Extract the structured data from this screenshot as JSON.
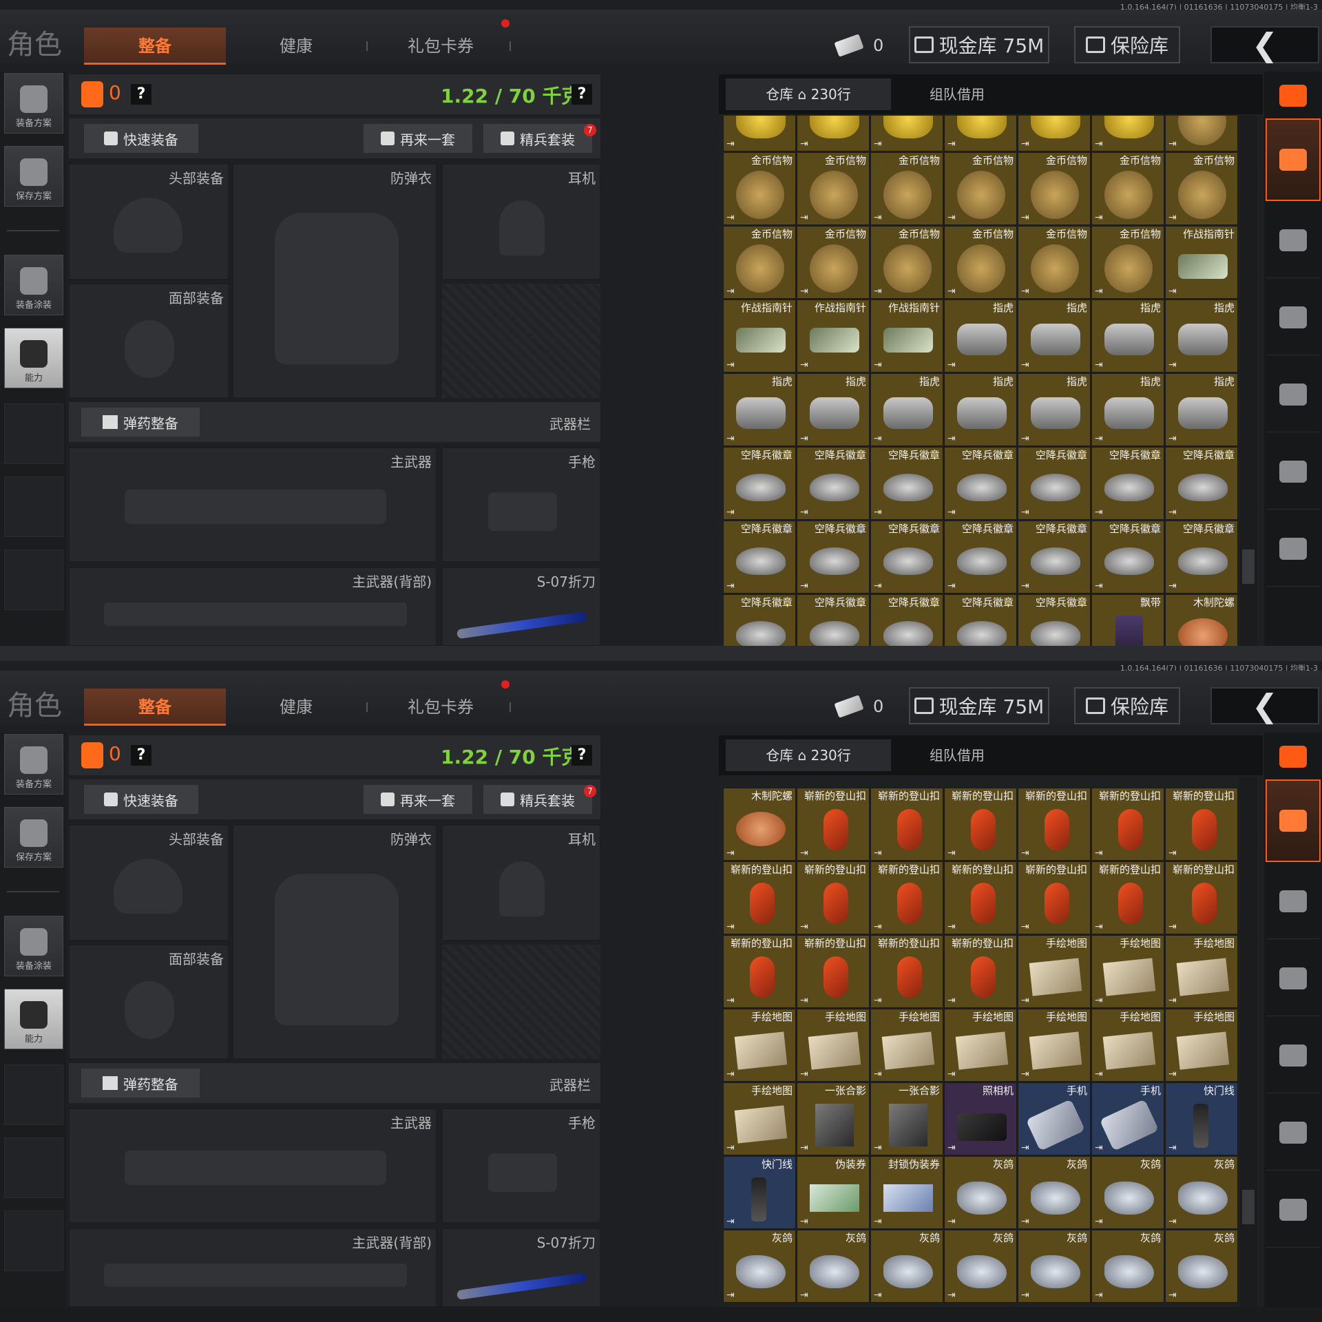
{
  "version_text": "1.0.164.164(7) | 01161636 | 11073040175 | 均衡1-3",
  "header": {
    "title": "角色",
    "tabs": [
      {
        "label": "整备",
        "active": true
      },
      {
        "label": "健康",
        "active": false
      },
      {
        "label": "礼包卡券",
        "active": false
      }
    ],
    "ticket_count": "0",
    "cash_vault": "现金库 75M",
    "safe": "保险库",
    "back_icon": "chevron-left-icon"
  },
  "sidebar": {
    "items": [
      {
        "label": "装备方案",
        "icon": "backpack-icon"
      },
      {
        "label": "保存方案",
        "icon": "download-icon"
      },
      {
        "label": "装备涂装",
        "icon": "helmet-paint-icon"
      },
      {
        "label": "能力",
        "icon": "lightning-icon"
      }
    ]
  },
  "loadout": {
    "armor_count": "0",
    "help": "?",
    "weight": "1.22 / 70 千克",
    "quick_equip": "快速装备",
    "repeat": "再来一套",
    "elite_set": "精兵套装",
    "elite_badge": "7",
    "slots": {
      "head": "头部装备",
      "vest": "防弹衣",
      "earphones": "耳机",
      "face": "面部装备"
    },
    "ammo_btn": "弹药整备",
    "weapon_bar": "武器栏",
    "weapons": {
      "primary": "主武器",
      "pistol": "手枪",
      "primary_back": "主武器(背部)",
      "knife": "S-07折刀"
    }
  },
  "inventory": {
    "tab_warehouse": "仓库",
    "row_count": "230行",
    "tab_team": "组队借用",
    "panel1_rows": [
      [
        {
          "n": "",
          "t": "gold"
        },
        {
          "n": "",
          "t": "gold"
        },
        {
          "n": "",
          "t": "gold"
        },
        {
          "n": "",
          "t": "gold"
        },
        {
          "n": "",
          "t": "gold"
        },
        {
          "n": "",
          "t": "gold"
        },
        {
          "n": "",
          "t": "coin"
        }
      ],
      [
        {
          "n": "金币信物",
          "t": "coin"
        },
        {
          "n": "金币信物",
          "t": "coin"
        },
        {
          "n": "金币信物",
          "t": "coin"
        },
        {
          "n": "金币信物",
          "t": "coin"
        },
        {
          "n": "金币信物",
          "t": "coin"
        },
        {
          "n": "金币信物",
          "t": "coin"
        },
        {
          "n": "金币信物",
          "t": "coin"
        }
      ],
      [
        {
          "n": "金币信物",
          "t": "coin"
        },
        {
          "n": "金币信物",
          "t": "coin"
        },
        {
          "n": "金币信物",
          "t": "coin"
        },
        {
          "n": "金币信物",
          "t": "coin"
        },
        {
          "n": "金币信物",
          "t": "coin"
        },
        {
          "n": "金币信物",
          "t": "coin"
        },
        {
          "n": "作战指南针",
          "t": "compass"
        }
      ],
      [
        {
          "n": "作战指南针",
          "t": "compass"
        },
        {
          "n": "作战指南针",
          "t": "compass"
        },
        {
          "n": "作战指南针",
          "t": "compass"
        },
        {
          "n": "指虎",
          "t": "knuckle"
        },
        {
          "n": "指虎",
          "t": "knuckle"
        },
        {
          "n": "指虎",
          "t": "knuckle"
        },
        {
          "n": "指虎",
          "t": "knuckle"
        }
      ],
      [
        {
          "n": "指虎",
          "t": "knuckle"
        },
        {
          "n": "指虎",
          "t": "knuckle"
        },
        {
          "n": "指虎",
          "t": "knuckle"
        },
        {
          "n": "指虎",
          "t": "knuckle"
        },
        {
          "n": "指虎",
          "t": "knuckle"
        },
        {
          "n": "指虎",
          "t": "knuckle"
        },
        {
          "n": "指虎",
          "t": "knuckle"
        }
      ],
      [
        {
          "n": "空降兵徽章",
          "t": "badge"
        },
        {
          "n": "空降兵徽章",
          "t": "badge"
        },
        {
          "n": "空降兵徽章",
          "t": "badge"
        },
        {
          "n": "空降兵徽章",
          "t": "badge"
        },
        {
          "n": "空降兵徽章",
          "t": "badge"
        },
        {
          "n": "空降兵徽章",
          "t": "badge"
        },
        {
          "n": "空降兵徽章",
          "t": "badge"
        }
      ],
      [
        {
          "n": "空降兵徽章",
          "t": "badge"
        },
        {
          "n": "空降兵徽章",
          "t": "badge"
        },
        {
          "n": "空降兵徽章",
          "t": "badge"
        },
        {
          "n": "空降兵徽章",
          "t": "badge"
        },
        {
          "n": "空降兵徽章",
          "t": "badge"
        },
        {
          "n": "空降兵徽章",
          "t": "badge"
        },
        {
          "n": "空降兵徽章",
          "t": "badge"
        }
      ],
      [
        {
          "n": "空降兵徽章",
          "t": "badge"
        },
        {
          "n": "空降兵徽章",
          "t": "badge"
        },
        {
          "n": "空降兵徽章",
          "t": "badge"
        },
        {
          "n": "空降兵徽章",
          "t": "badge"
        },
        {
          "n": "空降兵徽章",
          "t": "badge"
        },
        {
          "n": "飘带",
          "t": "ribbon"
        },
        {
          "n": "木制陀螺",
          "t": "top"
        }
      ]
    ],
    "panel2_rows": [
      [
        {
          "n": "木制陀螺",
          "t": "top"
        },
        {
          "n": "崭新的登山扣",
          "t": "clip"
        },
        {
          "n": "崭新的登山扣",
          "t": "clip"
        },
        {
          "n": "崭新的登山扣",
          "t": "clip"
        },
        {
          "n": "崭新的登山扣",
          "t": "clip"
        },
        {
          "n": "崭新的登山扣",
          "t": "clip"
        },
        {
          "n": "崭新的登山扣",
          "t": "clip"
        }
      ],
      [
        {
          "n": "崭新的登山扣",
          "t": "clip"
        },
        {
          "n": "崭新的登山扣",
          "t": "clip"
        },
        {
          "n": "崭新的登山扣",
          "t": "clip"
        },
        {
          "n": "崭新的登山扣",
          "t": "clip"
        },
        {
          "n": "崭新的登山扣",
          "t": "clip"
        },
        {
          "n": "崭新的登山扣",
          "t": "clip"
        },
        {
          "n": "崭新的登山扣",
          "t": "clip"
        }
      ],
      [
        {
          "n": "崭新的登山扣",
          "t": "clip"
        },
        {
          "n": "崭新的登山扣",
          "t": "clip"
        },
        {
          "n": "崭新的登山扣",
          "t": "clip"
        },
        {
          "n": "崭新的登山扣",
          "t": "clip"
        },
        {
          "n": "手绘地图",
          "t": "map"
        },
        {
          "n": "手绘地图",
          "t": "map"
        },
        {
          "n": "手绘地图",
          "t": "map"
        }
      ],
      [
        {
          "n": "手绘地图",
          "t": "map"
        },
        {
          "n": "手绘地图",
          "t": "map"
        },
        {
          "n": "手绘地图",
          "t": "map"
        },
        {
          "n": "手绘地图",
          "t": "map"
        },
        {
          "n": "手绘地图",
          "t": "map"
        },
        {
          "n": "手绘地图",
          "t": "map"
        },
        {
          "n": "手绘地图",
          "t": "map"
        }
      ],
      [
        {
          "n": "手绘地图",
          "t": "map"
        },
        {
          "n": "一张合影",
          "t": "photo"
        },
        {
          "n": "一张合影",
          "t": "photo"
        },
        {
          "n": "照相机",
          "t": "camera",
          "c": "purple"
        },
        {
          "n": "手机",
          "t": "phone",
          "c": "blue"
        },
        {
          "n": "手机",
          "t": "phone",
          "c": "blue"
        },
        {
          "n": "快门线",
          "t": "shutter",
          "c": "blue"
        }
      ],
      [
        {
          "n": "快门线",
          "t": "shutter",
          "c": "blue"
        },
        {
          "n": "伪装券",
          "t": "fake"
        },
        {
          "n": "封锁伪装券",
          "t": "fake2"
        },
        {
          "n": "灰鸽",
          "t": "pigeon"
        },
        {
          "n": "灰鸽",
          "t": "pigeon"
        },
        {
          "n": "灰鸽",
          "t": "pigeon"
        },
        {
          "n": "灰鸽",
          "t": "pigeon"
        }
      ],
      [
        {
          "n": "灰鸽",
          "t": "pigeon"
        },
        {
          "n": "灰鸽",
          "t": "pigeon"
        },
        {
          "n": "灰鸽",
          "t": "pigeon"
        },
        {
          "n": "灰鸽",
          "t": "pigeon"
        },
        {
          "n": "灰鸽",
          "t": "pigeon"
        },
        {
          "n": "灰鸽",
          "t": "pigeon"
        },
        {
          "n": "灰鸽",
          "t": "pigeon"
        }
      ]
    ]
  },
  "right_sidebar": [
    "stack-icon",
    "stack-icon",
    "helmet-icon",
    "rifle-icon",
    "magazine-icon",
    "bullet-icon",
    "vest-icon"
  ],
  "colors": {
    "accent": "#ff5a14",
    "weight_green": "#7ed23c",
    "item_gold_bg": "#5a4a1a",
    "item_blue_bg": "#2a3a5a",
    "item_purple_bg": "#3b2a4a"
  }
}
